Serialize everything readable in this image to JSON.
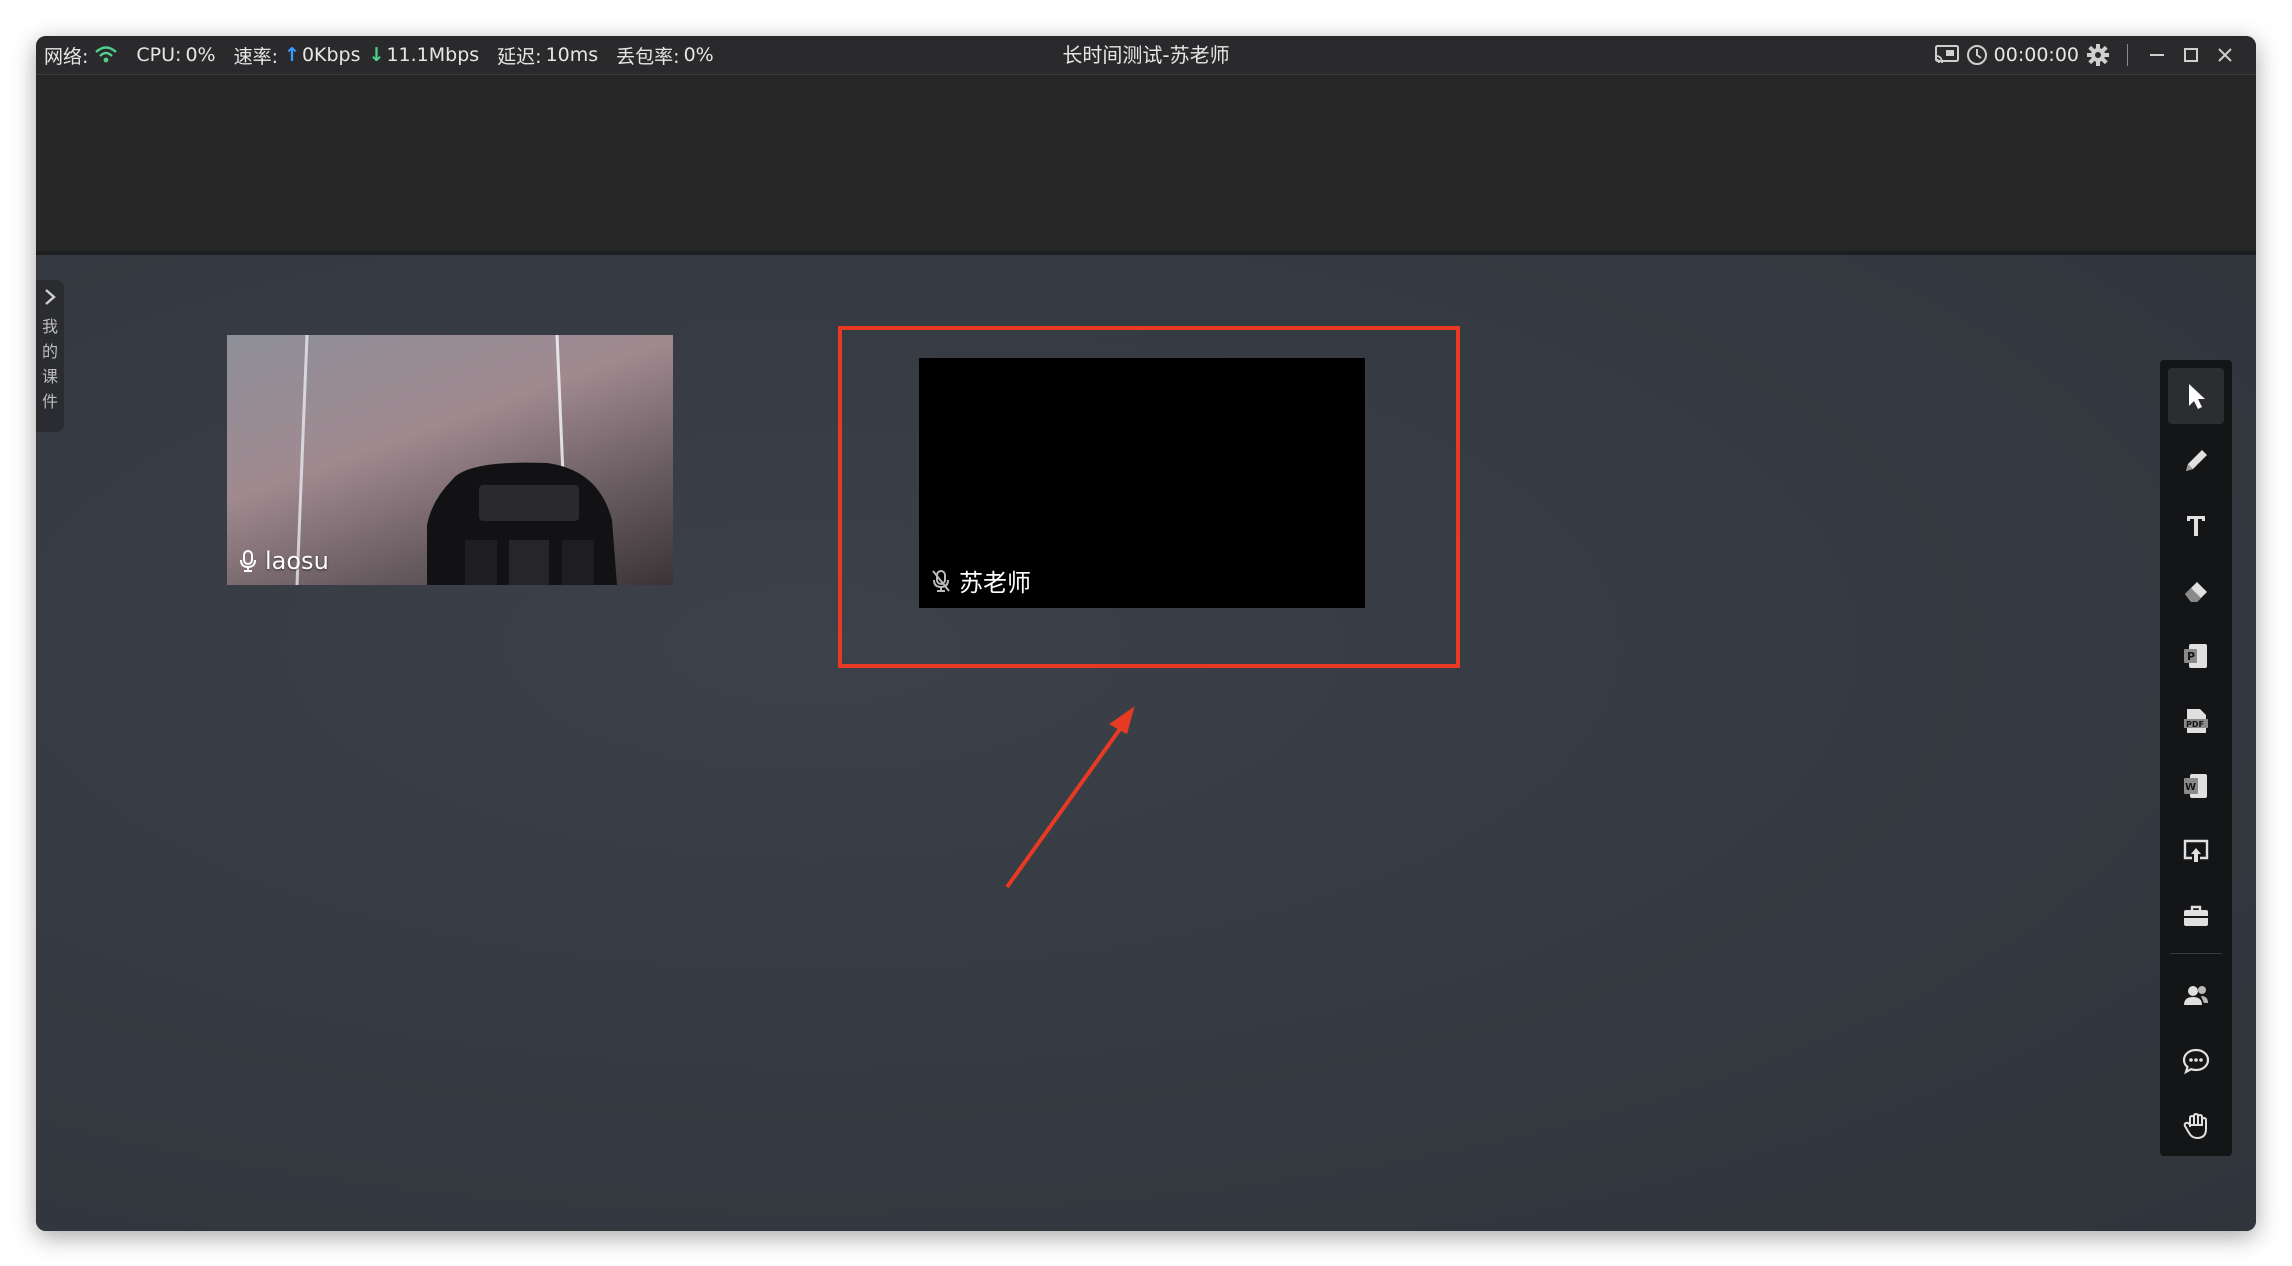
{
  "titlebar": {
    "network_label": "网络:",
    "cpu_label": "CPU:",
    "cpu_value": "0%",
    "speed_label": "速率:",
    "upload": "0Kbps",
    "download": "11.1Mbps",
    "latency_label": "延迟:",
    "latency_value": "10ms",
    "loss_label": "丢包率:",
    "loss_value": "0%",
    "title": "长时间测试-苏老师",
    "timer": "00:00:00"
  },
  "course_tab": {
    "label": "我的课件"
  },
  "videos": {
    "self": {
      "name": "laosu",
      "mic": "on"
    },
    "teacher": {
      "name": "苏老师",
      "mic": "muted"
    }
  },
  "toolbar": {
    "tools": [
      "pointer-icon",
      "pencil-icon",
      "text-icon",
      "eraser-icon",
      "ppt-icon",
      "pdf-icon",
      "word-icon",
      "screen-share-icon",
      "toolbox-icon",
      "users-icon",
      "chat-icon",
      "raise-hand-icon"
    ]
  },
  "colors": {
    "highlight": "#e83a23",
    "upload_arrow": "#3b9cff",
    "download_arrow": "#4fd18b",
    "wifi": "#4fd18b"
  }
}
